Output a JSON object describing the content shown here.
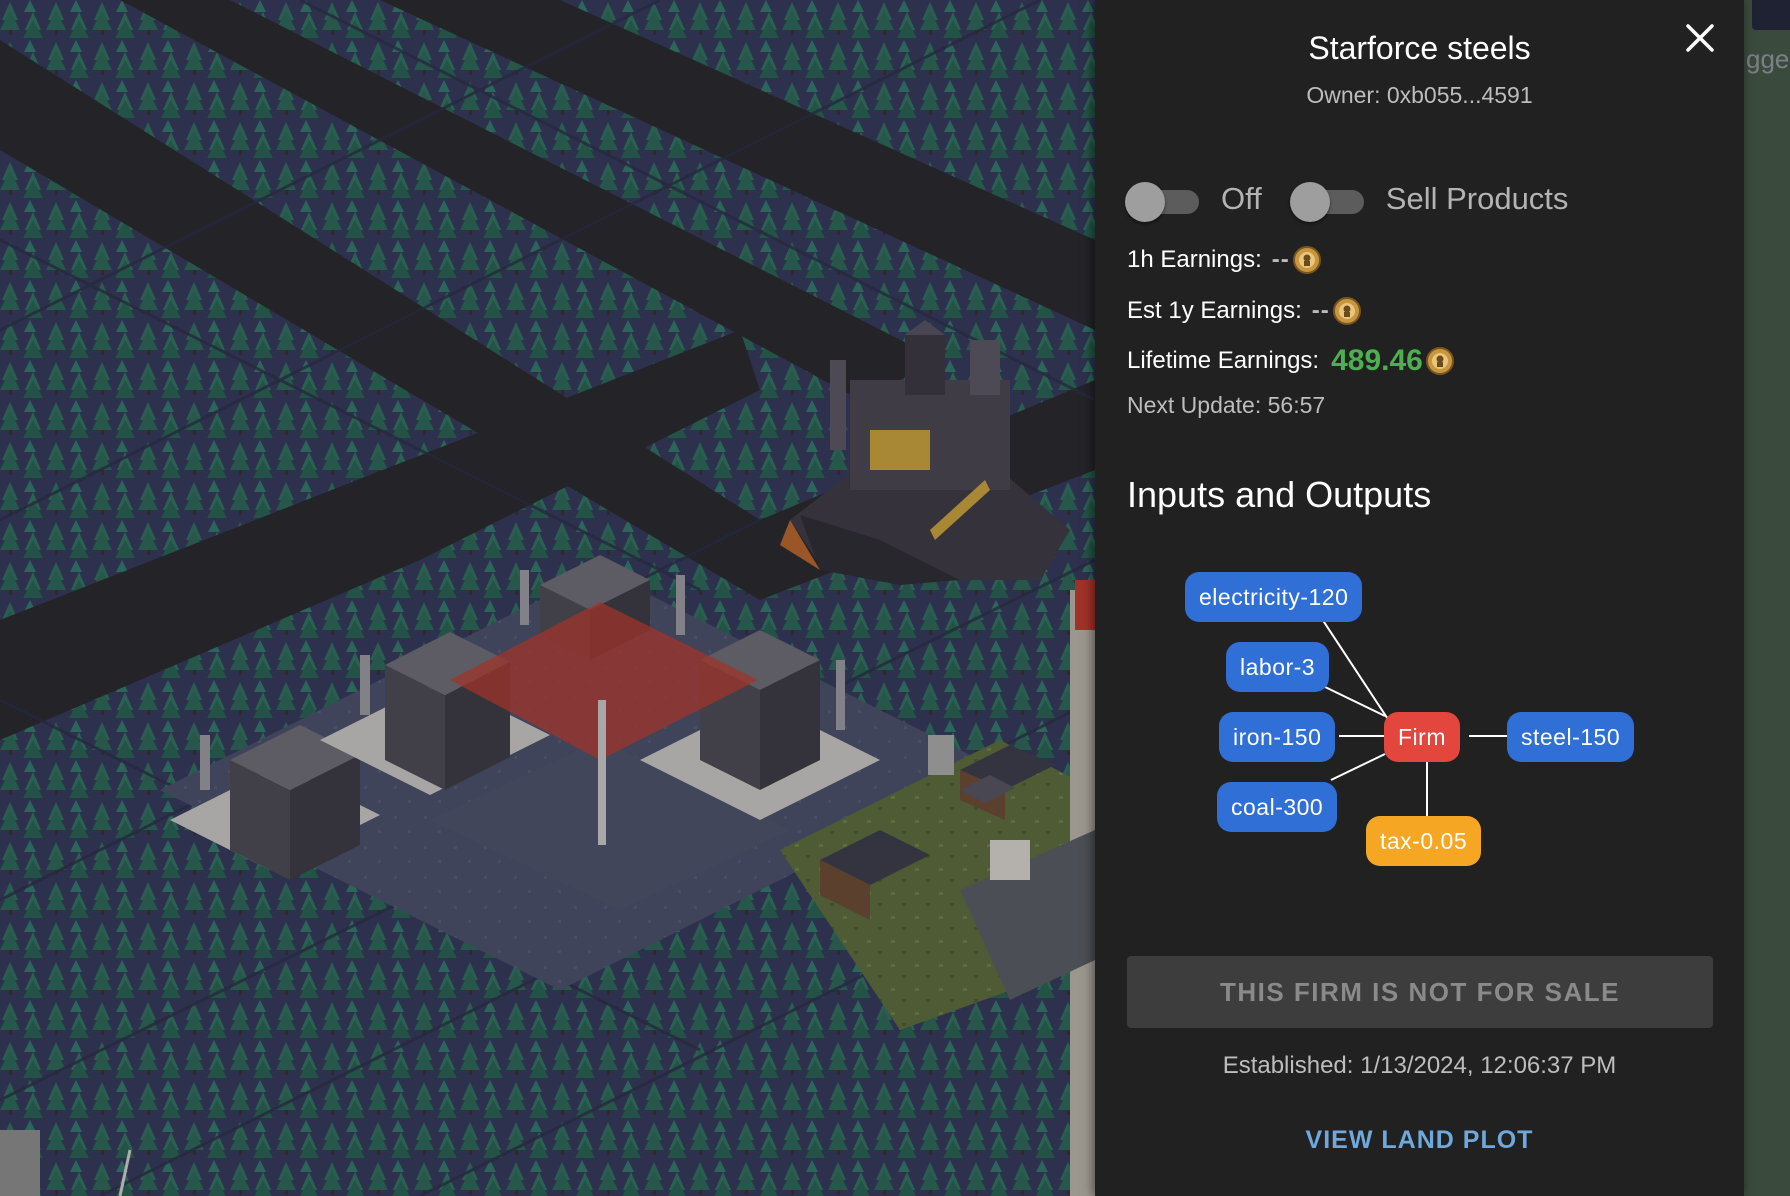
{
  "panel": {
    "title": "Starforce steels",
    "owner": "Owner: 0xb055...4591",
    "toggles": [
      {
        "label": "Off",
        "checked": false
      },
      {
        "label": "Sell Products",
        "checked": false
      }
    ],
    "stats": {
      "hour_label": "1h Earnings:",
      "hour_value": "--",
      "year_label": "Est 1y Earnings:",
      "year_value": "--",
      "lifetime_label": "Lifetime Earnings:",
      "lifetime_value": "489.46"
    },
    "next_update": "Next Update: 56:57",
    "io_heading": "Inputs and Outputs",
    "graph": {
      "center": "Firm",
      "inputs": [
        "electricity-120",
        "labor-3",
        "iron-150",
        "coal-300"
      ],
      "output": "steel-150",
      "tax": "tax-0.05"
    },
    "sale_button": "THIS FIRM IS NOT FOR SALE",
    "established": "Established: 1/13/2024, 12:06:37 PM",
    "view_land": "VIEW LAND PLOT"
  },
  "right_strip": {
    "edge_text": "gge"
  },
  "colors": {
    "panel_bg": "#212121",
    "node_input": "#2f6fd6",
    "node_firm": "#e2463d",
    "node_tax": "#f5a623",
    "earnings_green": "#4caf50",
    "link_blue": "#6fa8dc"
  },
  "icons": {
    "close": "close-icon",
    "coin": "coin-icon"
  }
}
